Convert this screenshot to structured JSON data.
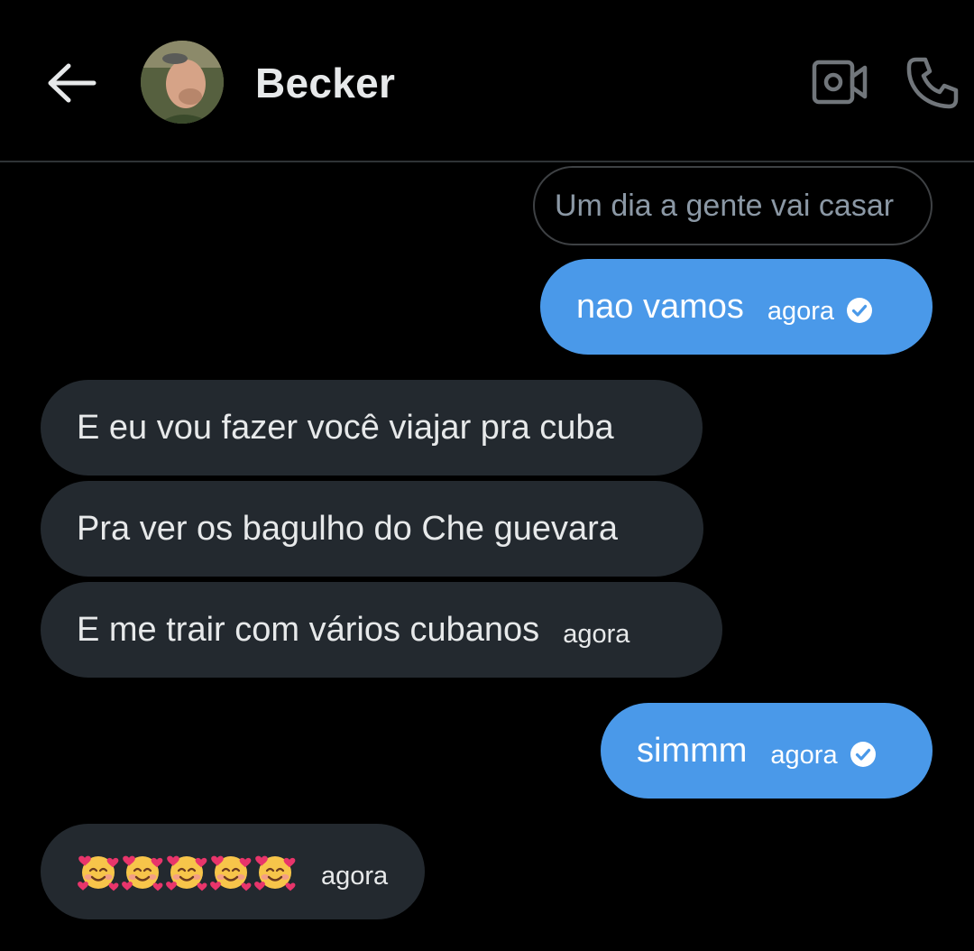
{
  "header": {
    "contact_name": "Becker",
    "icons": {
      "back": "arrow-left-icon",
      "video": "video-camera-icon",
      "call": "phone-icon"
    }
  },
  "messages": {
    "quoted_text": "Um dia a gente vai casar",
    "sent_1": {
      "text": "nao vamos",
      "time": "agora",
      "status_icon": "check-circle-icon"
    },
    "received_1": {
      "text": "E eu vou fazer você viajar pra cuba"
    },
    "received_2": {
      "text": "Pra ver os bagulho do Che guevara"
    },
    "received_3": {
      "text": "E me trair com vários cubanos",
      "time": "agora"
    },
    "sent_2": {
      "text": "simmm",
      "time": "agora",
      "status_icon": "check-circle-icon"
    },
    "received_4": {
      "emoji_name": "smiling-face-with-hearts-emoji",
      "emoji_count": 5,
      "time": "agora"
    }
  },
  "colors": {
    "background": "#000000",
    "sent_bubble": "#4a99e9",
    "received_bubble": "#23292f",
    "text_primary": "#e7e9ea",
    "text_muted": "#8b98a5"
  }
}
